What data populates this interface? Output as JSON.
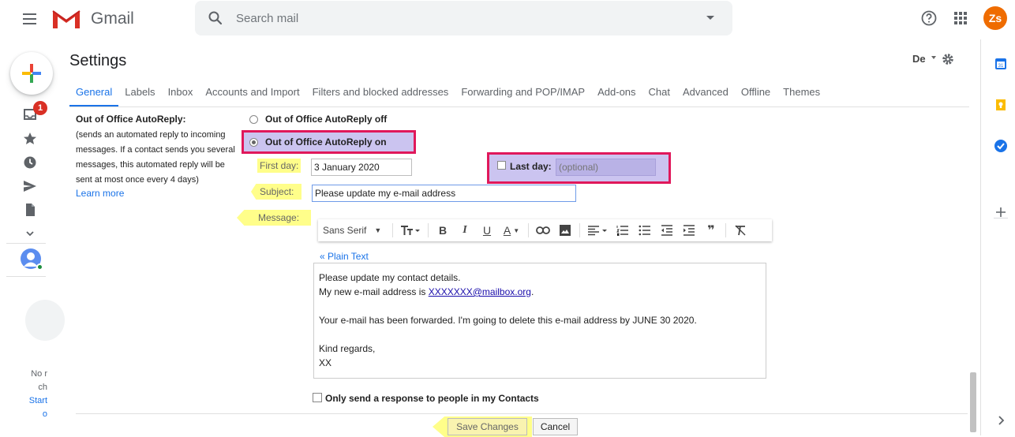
{
  "header": {
    "brand": "Gmail",
    "search_placeholder": "Search mail",
    "avatar_initials": "Zs"
  },
  "rail": {
    "badge_count": "1",
    "hint_lines": [
      "No r",
      "ch"
    ],
    "hint_link_lines": [
      "Start",
      "o"
    ]
  },
  "settings": {
    "title": "Settings",
    "density_label": "De",
    "tabs": [
      {
        "label": "General",
        "active": true
      },
      {
        "label": "Labels"
      },
      {
        "label": "Inbox"
      },
      {
        "label": "Accounts and Import"
      },
      {
        "label": "Filters and blocked addresses"
      },
      {
        "label": "Forwarding and POP/IMAP"
      },
      {
        "label": "Add-ons"
      },
      {
        "label": "Chat"
      },
      {
        "label": "Advanced"
      },
      {
        "label": "Offline"
      },
      {
        "label": "Themes"
      }
    ]
  },
  "ooo": {
    "section_label": "Out of Office AutoReply:",
    "description": "(sends an automated reply to incoming messages. If a contact sends you several messages, this automated reply will be sent at most once every 4 days)",
    "learn_more": "Learn more",
    "radio_off_label": "Out of Office AutoReply off",
    "radio_on_label": "Out of Office AutoReply on",
    "first_day_label": "First day:",
    "first_day_value": "3 January 2020",
    "last_day_label": "Last day:",
    "last_day_placeholder": "(optional)",
    "subject_label": "Subject:",
    "subject_value": "Please update my e-mail address",
    "message_label": "Message:",
    "plain_text_link": "« Plain Text",
    "message": {
      "line1": "Please update my contact details.",
      "line2_prefix": "My new e-mail address is ",
      "line2_email": "XXXXXXX@mailbox.org",
      "line2_suffix": ".",
      "line3": "Your e-mail has been forwarded. I'm going to delete this e-mail address by JUNE 30 2020.",
      "line4": "Kind regards,",
      "line5": "XX"
    },
    "contacts_only_label": "Only send a response to people in my Contacts",
    "save_label": "Save Changes",
    "cancel_label": "Cancel"
  },
  "toolbar": {
    "font_name": "Sans Serif",
    "bold": "B",
    "italic": "I",
    "underline": "U",
    "text_color": "A",
    "quote": "❞"
  },
  "colors": {
    "accent": "#1a73e8",
    "highlight_yellow": "#fffe8a",
    "highlight_purple": "#cbc4f0",
    "annotation_red": "#e0185b",
    "avatar": "#ef6c00",
    "badge": "#d93025"
  }
}
